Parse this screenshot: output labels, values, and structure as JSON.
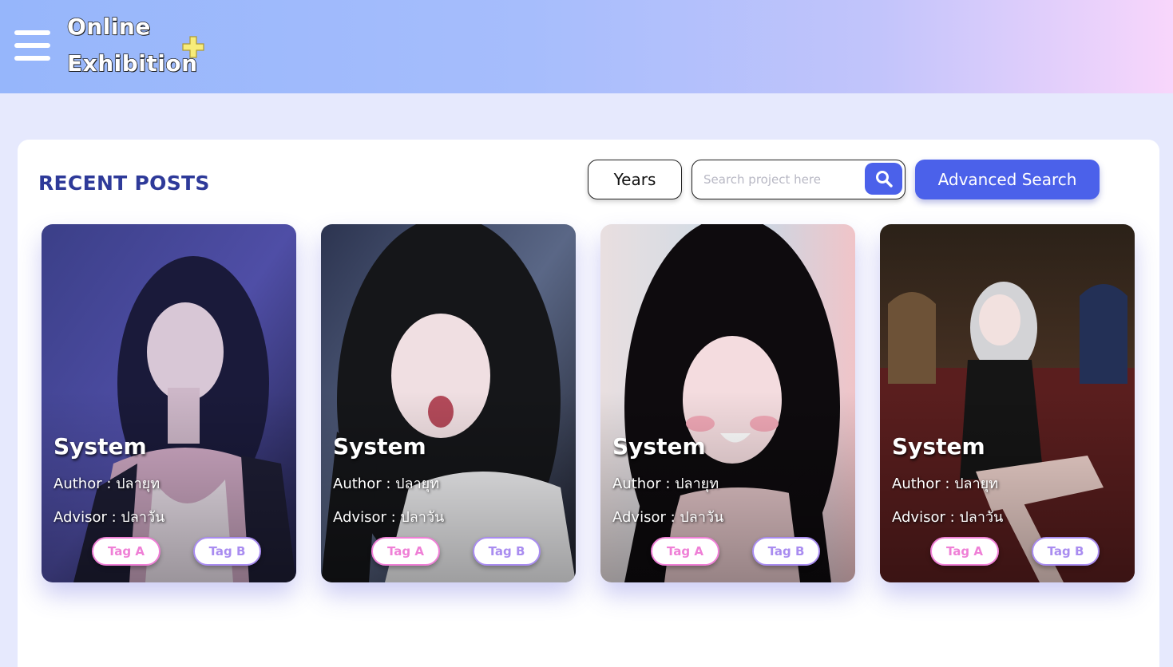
{
  "header": {
    "logo_line1": "Online",
    "logo_line2": "Exhibition",
    "menu_icon": "hamburger-menu-icon",
    "plus_icon": "plus-icon",
    "plus_color": "#f7ec7a"
  },
  "main": {
    "section_title": "RECENT POSTS",
    "years_button": "Years",
    "search": {
      "placeholder": "Search project here",
      "value": "",
      "icon": "search-icon"
    },
    "advanced_search_button": "Advanced Search",
    "accent_color": "#4b61ea"
  },
  "posts": [
    {
      "title": "System",
      "author": "Author : ปลายุท",
      "advisor": "Advisor : ปลาวัน",
      "tag_a": "Tag A",
      "tag_b": "Tag B"
    },
    {
      "title": "System",
      "author": "Author : ปลายุท",
      "advisor": "Advisor : ปลาวัน",
      "tag_a": "Tag A",
      "tag_b": "Tag B"
    },
    {
      "title": "System",
      "author": "Author : ปลายุท",
      "advisor": "Advisor : ปลาวัน",
      "tag_a": "Tag A",
      "tag_b": "Tag B"
    },
    {
      "title": "System",
      "author": "Author : ปลายุท",
      "advisor": "Advisor : ปลาวัน",
      "tag_a": "Tag A",
      "tag_b": "Tag B"
    }
  ],
  "tag_colors": {
    "tag_a": "#ef7fd6",
    "tag_b": "#a98cf0"
  }
}
